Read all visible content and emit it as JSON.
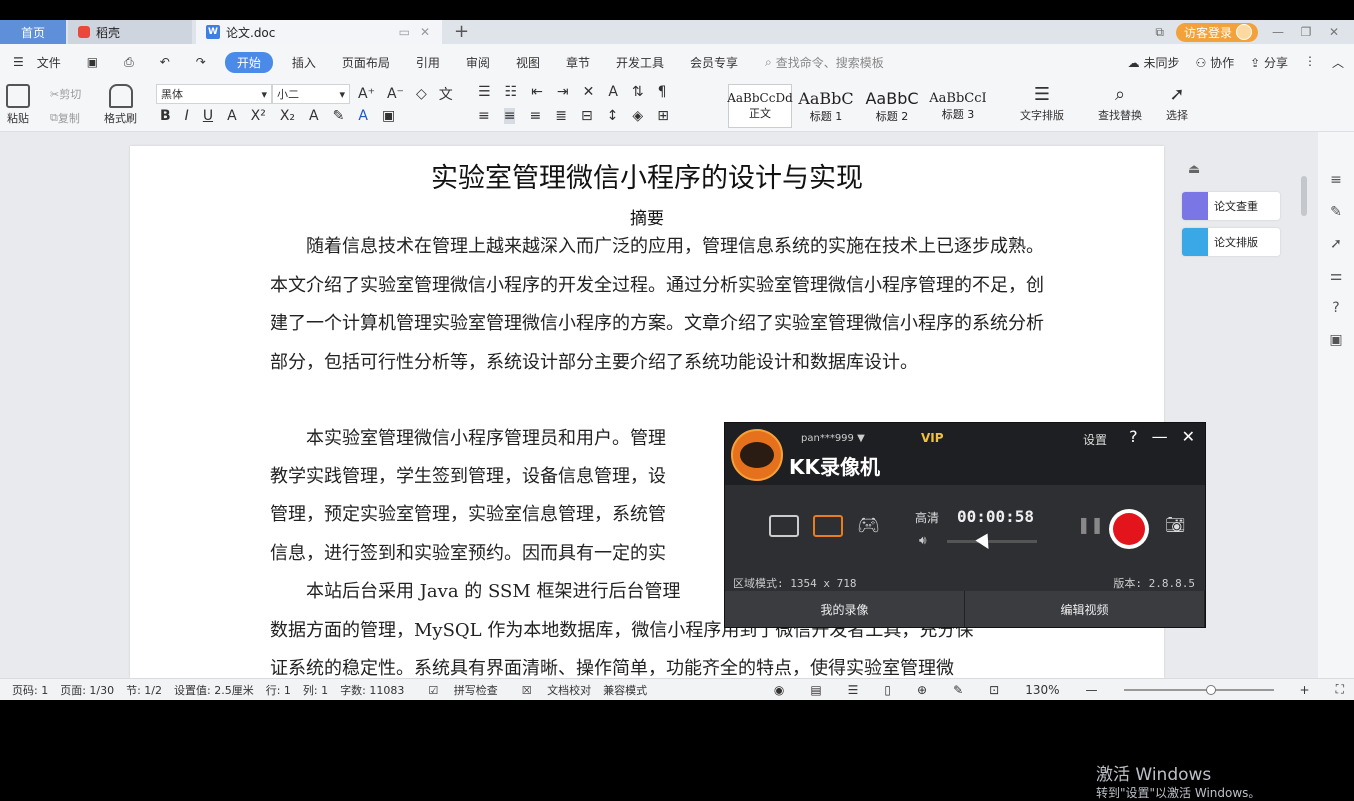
{
  "tabs": {
    "home": "首页",
    "daoke": "稻壳",
    "doc": "论文.doc",
    "plus": "+"
  },
  "titlebar": {
    "login": "访客登录"
  },
  "menu": {
    "file": "文件",
    "items": [
      "开始",
      "插入",
      "页面布局",
      "引用",
      "审阅",
      "视图",
      "章节",
      "开发工具",
      "会员专享"
    ],
    "search": "查找命令、搜索模板",
    "sync": "未同步",
    "collab": "协作",
    "share": "分享"
  },
  "ribbon": {
    "paste": "粘贴",
    "cut": "剪切",
    "copy": "复制",
    "format_painter": "格式刷",
    "font_name": "黑体",
    "font_size": "小二",
    "styles": [
      {
        "sample": "AaBbCcDd",
        "label": "正文"
      },
      {
        "sample": "AaBbC",
        "label": "标题 1"
      },
      {
        "sample": "AaBbC",
        "label": "标题 2"
      },
      {
        "sample": "AaBbCcI",
        "label": "标题 3"
      }
    ],
    "text_layout": "文字排版",
    "find_replace": "查找替换",
    "select": "选择"
  },
  "document": {
    "title": "实验室管理微信小程序的设计与实现",
    "abstract_heading": "摘要",
    "p1": "随着信息技术在管理上越来越深入而广泛的应用，管理信息系统的实施在技术上已逐步成熟。本文介绍了实验室管理微信小程序的开发全过程。通过分析实验室管理微信小程序管理的不足，创建了一个计算机管理实验室管理微信小程序的方案。文章介绍了实验室管理微信小程序的系统分析部分，包括可行性分析等，系统设计部分主要介绍了系统功能设计和数据库设计。",
    "p2": "本实验室管理微信小程序管理员和用户。管理",
    "p2b": "教学实践管理，学生签到管理，设备信息管理，设",
    "p2c": "管理，预定实验室管理，实验室信息管理，系统管",
    "p2d": "信息，进行签到和实验室预约。因而具有一定的实",
    "p3a": "本站后台采用 Java 的 SSM 框架进行后台管理",
    "p3b": "数据方面的管理，MySQL 作为本地数据库，微信小程序用到了微信开发者工具，充分保",
    "p3c": "证系统的稳定性。系统具有界面清晰、操作简单，功能齐全的特点，使得实验室管理微"
  },
  "side": {
    "check": "论文查重",
    "layout": "论文排版"
  },
  "kk": {
    "user": "pan***999",
    "vip": "VIP",
    "title": "KK录像机",
    "settings": "设置",
    "quality": "高清",
    "time": "00:00:58",
    "region": "区域模式: 1354 x 718",
    "version": "版本: 2.8.8.5",
    "my_recordings": "我的录像",
    "edit_video": "编辑视频"
  },
  "watermark": {
    "line1": "激活 Windows",
    "line2": "转到\"设置\"以激活 Windows。"
  },
  "status": {
    "page_code": "页码: 1",
    "page": "页面: 1/30",
    "section": "节: 1/2",
    "setting": "设置值: 2.5厘米",
    "row": "行: 1",
    "col": "列: 1",
    "words": "字数: 11083",
    "spell": "拼写检查",
    "proof": "文档校对",
    "compat": "兼容模式",
    "zoom": "130%"
  }
}
